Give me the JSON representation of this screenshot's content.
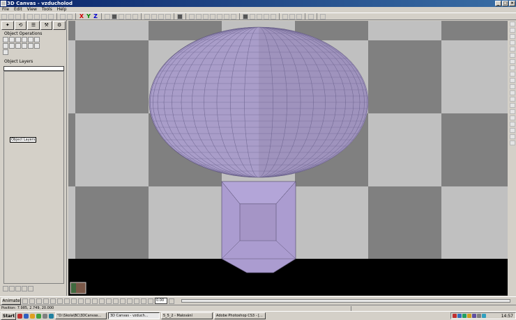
{
  "window": {
    "title": "3D Canvas - vzducholod"
  },
  "menu": [
    "File",
    "Edit",
    "View",
    "Tools",
    "Help"
  ],
  "left_panel": {
    "tabs": [
      "✦",
      "⟲",
      "☰",
      "⚒",
      "⚙"
    ],
    "object_operations_label": "Object Operations",
    "object_layers_label": "Object Layers",
    "layers_tooltip": "Object Layers"
  },
  "viewport": {
    "colors": {
      "checker_light": "#c0c0c0",
      "checker_dark": "#808080",
      "object": "#b0a0d0",
      "floor": "#000000"
    }
  },
  "timeline": {
    "animate_label": "Animate",
    "time_value": "0.00"
  },
  "status": {
    "position": "Position: 7.985, 2.749, 20.000"
  },
  "taskbar": {
    "start_label": "Start",
    "tasks": [
      {
        "label": "\"D:\\Skola\\BC\\3DCanvas..."
      },
      {
        "label": "3D Canvas - vzduch..."
      },
      {
        "label": "5_5_2 - Malování"
      },
      {
        "label": "Adobe Photoshop CS3 - [..."
      }
    ],
    "clock": "14:57"
  }
}
